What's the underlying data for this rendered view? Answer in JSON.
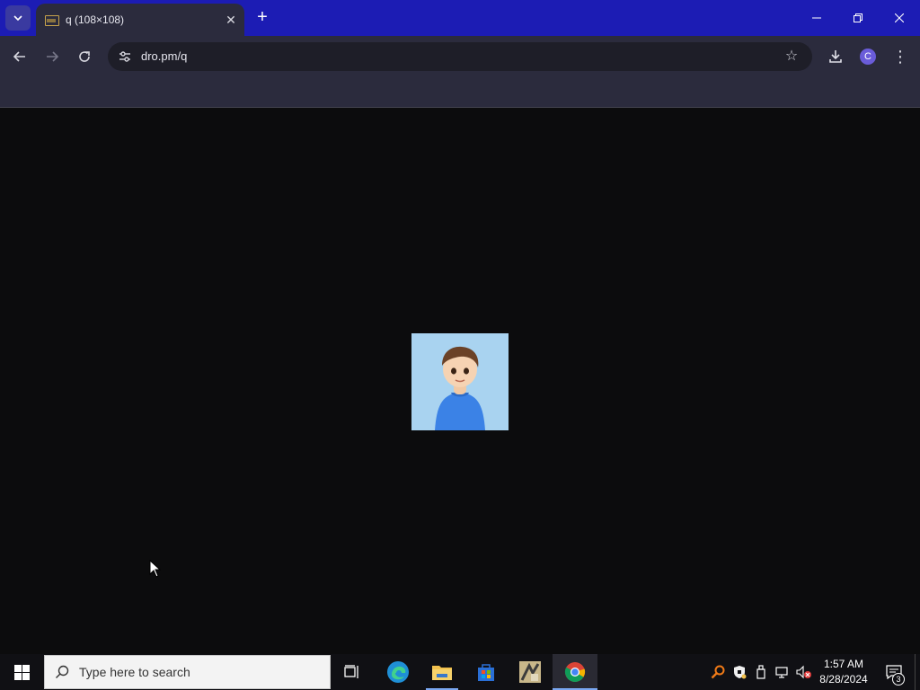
{
  "browser": {
    "tab_title": "q (108×108)",
    "url": "dro.pm/q",
    "profile_initial": "C",
    "icons": {
      "tab_menu": "chevron-down-icon",
      "tab_close": "close-icon",
      "new_tab": "plus-icon",
      "back": "back-arrow-icon",
      "forward": "forward-arrow-icon",
      "reload": "reload-icon",
      "site_info": "tune-icon",
      "bookmark": "star-icon",
      "download": "download-icon",
      "menu": "kebab-menu-icon"
    }
  },
  "window_controls": {
    "minimize": "minimize-icon",
    "restore": "restore-icon",
    "close": "close-icon"
  },
  "content": {
    "image": "avatar-image",
    "image_size": "108×108"
  },
  "taskbar": {
    "search_placeholder": "Type here to search",
    "apps": [
      "task-view",
      "microsoft-edge",
      "file-explorer",
      "microsoft-store",
      "game-app",
      "google-chrome"
    ],
    "clock_time": "1:57 AM",
    "clock_date": "8/28/2024",
    "notification_count": "3"
  },
  "colors": {
    "titlebar": "#1c1cb4",
    "toolbar": "#2b2b3d",
    "page_bg": "#0c0c0d",
    "taskbar": "#101014"
  }
}
